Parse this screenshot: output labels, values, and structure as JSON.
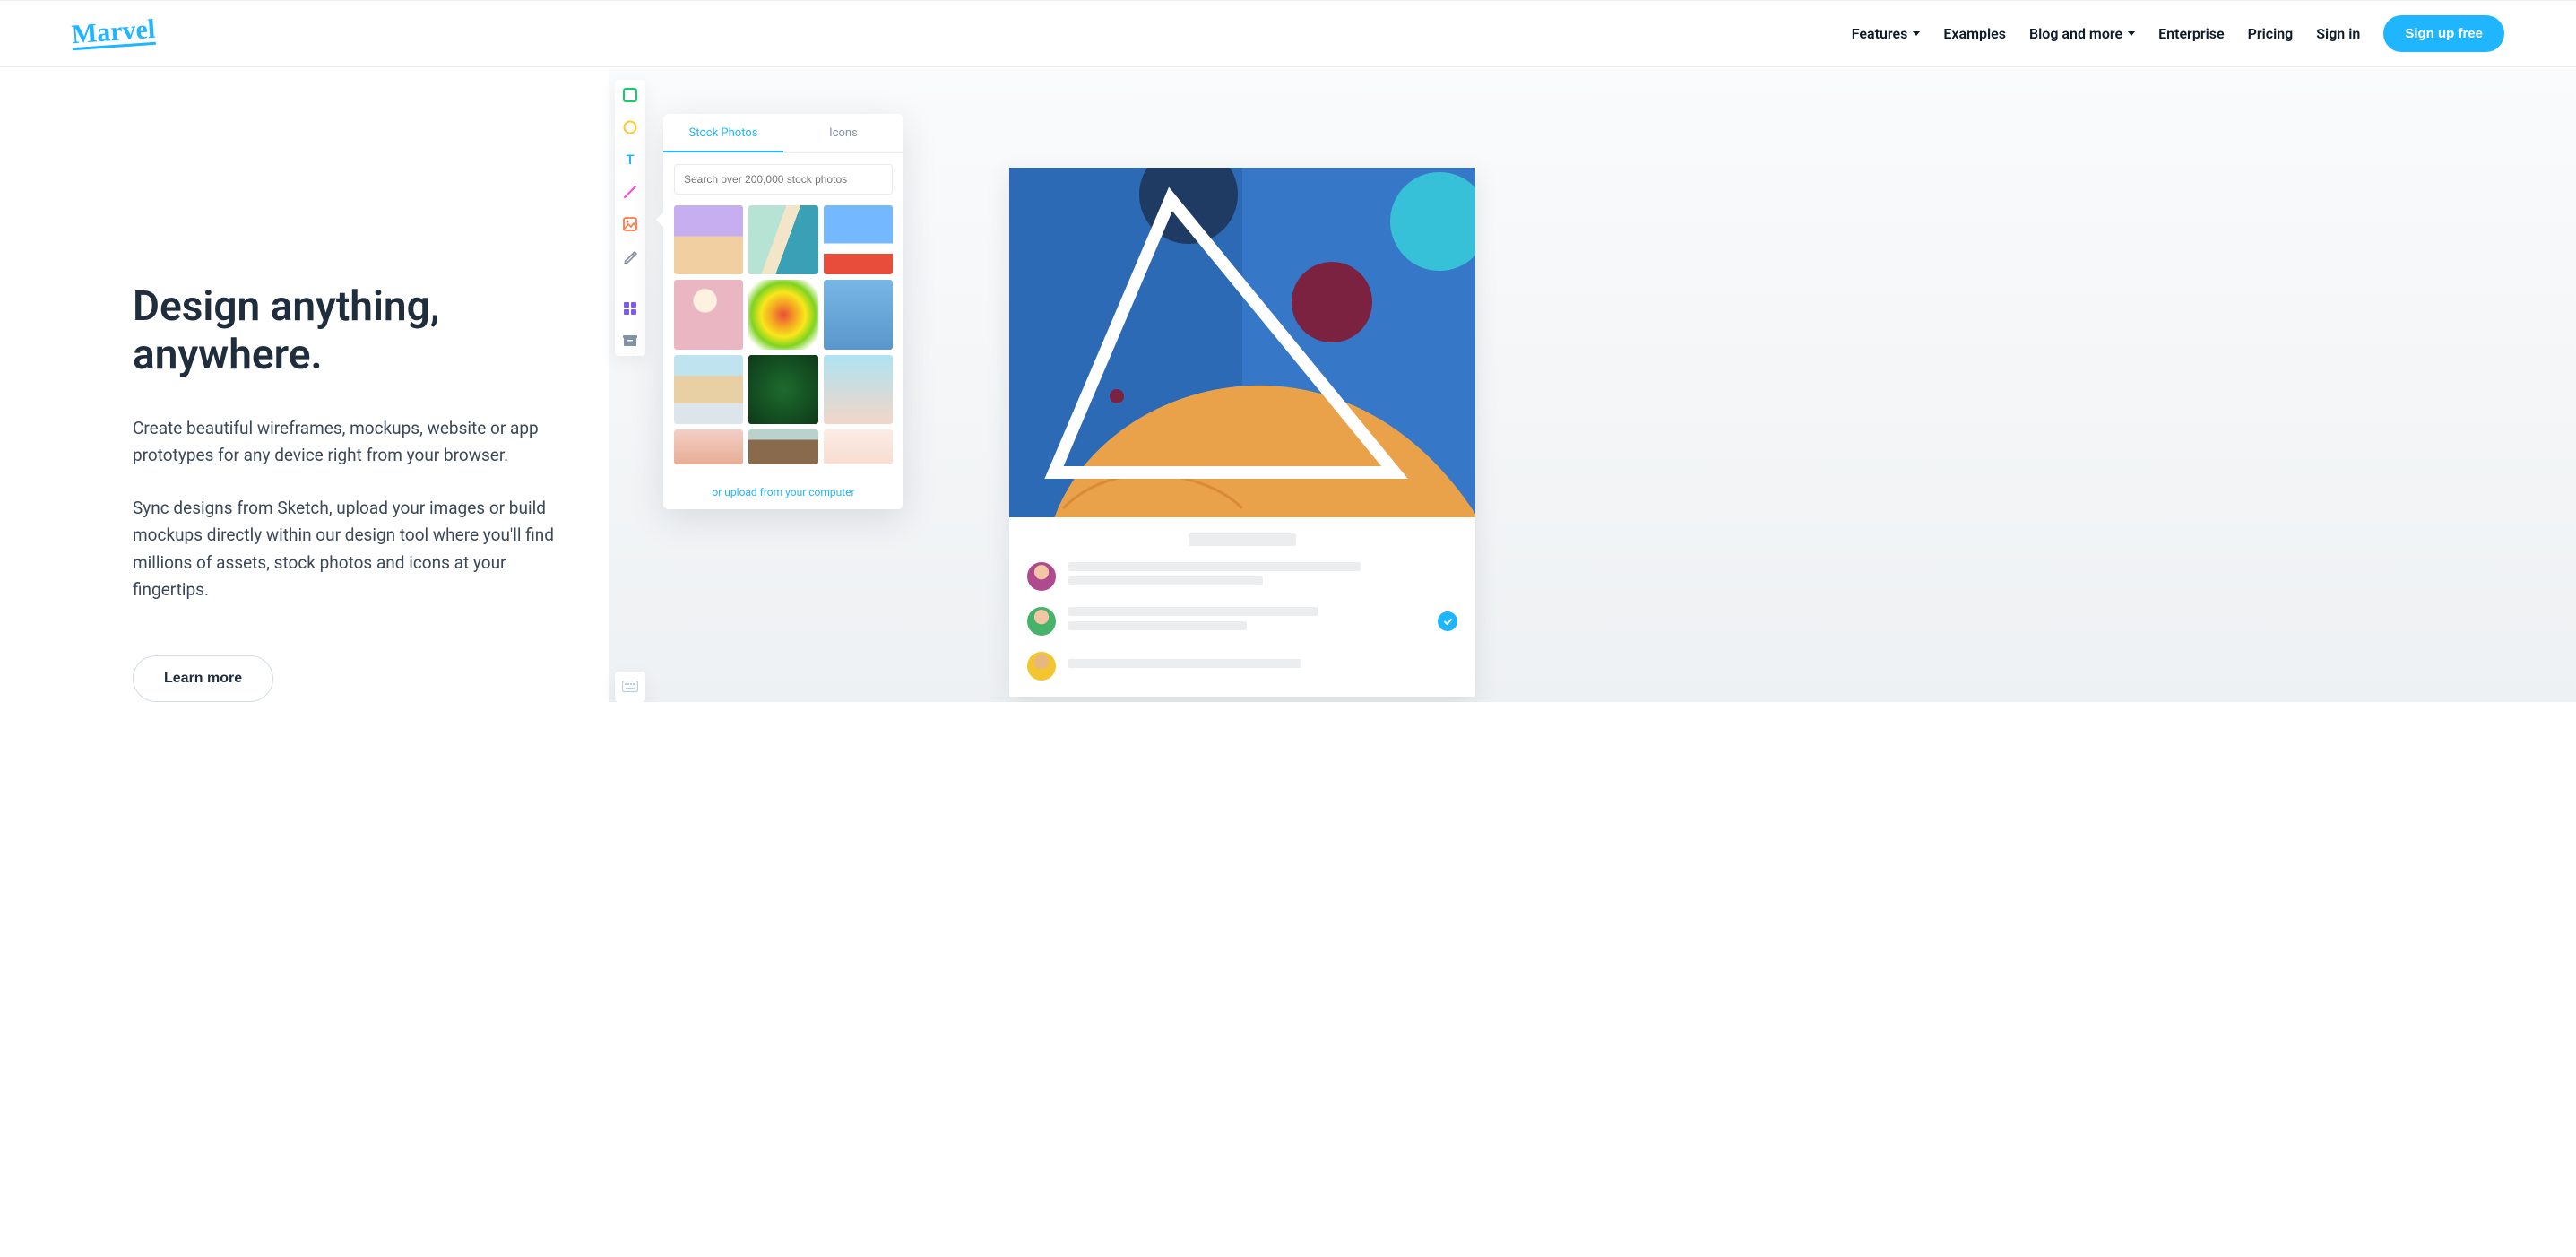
{
  "brand": "Marvel",
  "nav": {
    "features": "Features",
    "examples": "Examples",
    "blog": "Blog and more",
    "enterprise": "Enterprise",
    "pricing": "Pricing",
    "signin": "Sign in",
    "signup": "Sign up free"
  },
  "hero": {
    "title": "Design anything, anywhere.",
    "p1": "Create beautiful wireframes, mockups, website or app prototypes for any device right from your browser.",
    "p2": "Sync designs from Sketch, upload your images or build mockups directly within our design tool where you'll find millions of assets, stock photos and icons at your fingertips.",
    "cta": "Learn more"
  },
  "tools": {
    "rectangle": "rectangle-icon",
    "circle": "circle-icon",
    "text": "text-icon",
    "line": "line-icon",
    "image": "image-icon",
    "pen": "pen-icon",
    "grid": "grid-icon",
    "archive": "archive-icon",
    "keyboard": "keyboard-icon"
  },
  "panel": {
    "tab_stock": "Stock Photos",
    "tab_icons": "Icons",
    "search_placeholder": "Search over 200,000 stock photos",
    "upload": "or upload from your computer"
  },
  "colors": {
    "primary": "#1FB6FF",
    "accent_orange": "#f6b042"
  }
}
